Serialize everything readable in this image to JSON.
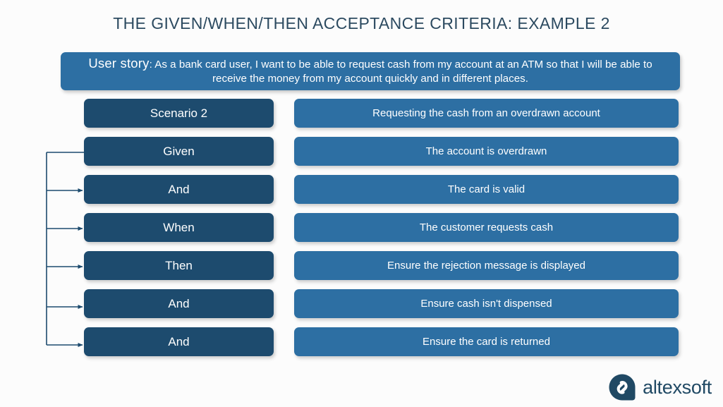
{
  "page": {
    "title": "THE GIVEN/WHEN/THEN ACCEPTANCE CRITERIA: EXAMPLE 2",
    "background_color": "#fcfcfc",
    "title_color": "#2c4a60"
  },
  "user_story": {
    "label": "User story",
    "separator": ": ",
    "text": "As a bank card user, I want to be able to request cash from my account at an ATM so that I will be able to receive the money from my account quickly and in different places.",
    "background_color": "#2d6fa3",
    "text_color": "#ffffff"
  },
  "colors": {
    "left_box": "#1d4b6e",
    "right_box": "#2d6fa3",
    "connector": "#1d4b6e",
    "logo": "#204964"
  },
  "rows": [
    {
      "keyword": "Scenario 2",
      "description": "Requesting the cash from an overdrawn account",
      "has_connector": false,
      "has_arrowhead": false
    },
    {
      "keyword": "Given",
      "description": "The account is overdrawn",
      "has_connector": true,
      "has_arrowhead": false
    },
    {
      "keyword": "And",
      "description": "The card is valid",
      "has_connector": true,
      "has_arrowhead": true
    },
    {
      "keyword": "When",
      "description": "The customer requests cash",
      "has_connector": true,
      "has_arrowhead": true
    },
    {
      "keyword": "Then",
      "description": "Ensure the rejection message is displayed",
      "has_connector": true,
      "has_arrowhead": true
    },
    {
      "keyword": "And",
      "description": "Ensure cash isn't dispensed",
      "has_connector": true,
      "has_arrowhead": true
    },
    {
      "keyword": "And",
      "description": "Ensure the card is returned",
      "has_connector": true,
      "has_arrowhead": true
    }
  ],
  "logo": {
    "wordmark": "altexsoft",
    "mark_name": "altexsoft-speech-bubble-mark"
  }
}
